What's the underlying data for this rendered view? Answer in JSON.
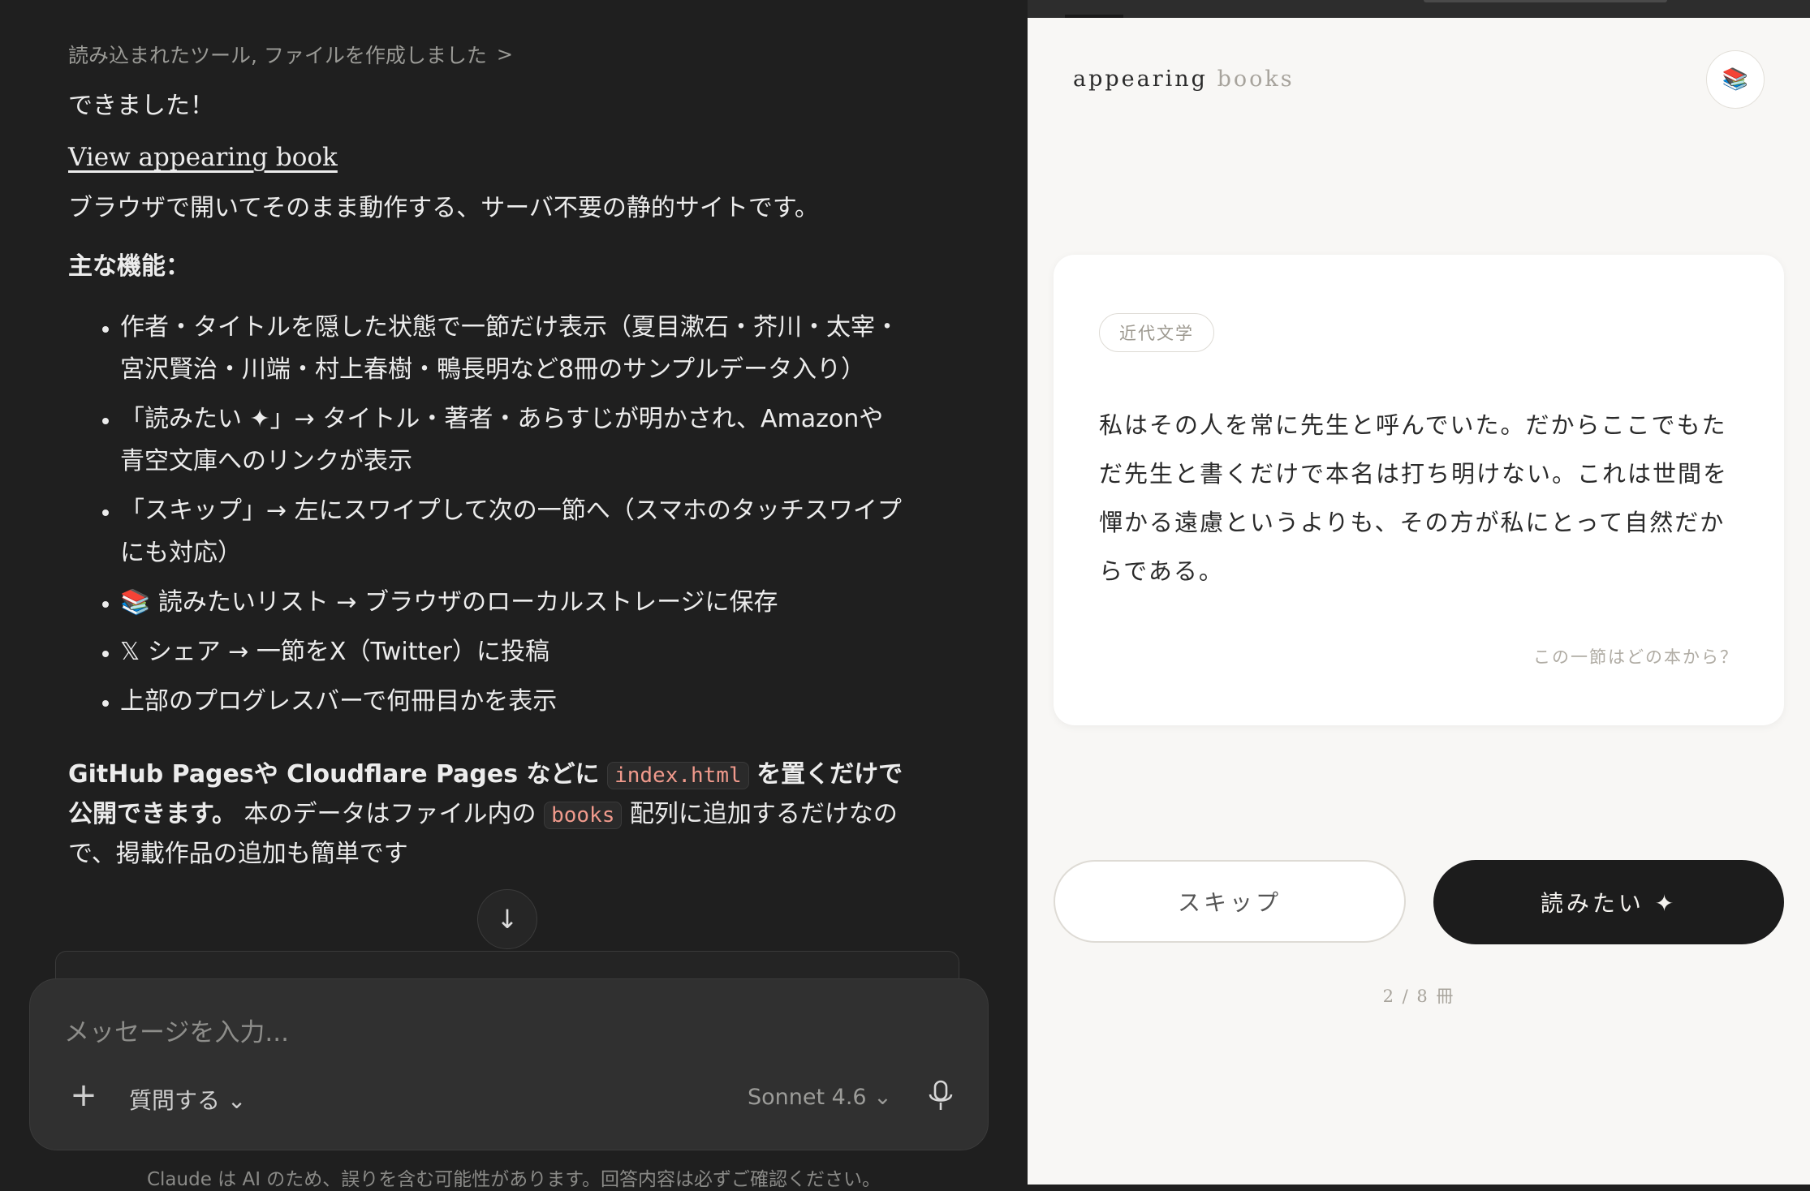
{
  "chat": {
    "tools_summary": "読み込まれたツール, ファイルを作成しました",
    "done_text": "できました！",
    "artifact_link": "View appearing book",
    "description": "ブラウザで開いてそのまま動作する、サーバ不要の静的サイトです。",
    "features_title": "主な機能：",
    "features": [
      "作者・タイトルを隠した状態で一節だけ表示（夏目漱石・芥川・太宰・宮沢賢治・川端・村上春樹・鴨長明など8冊のサンプルデータ入り）",
      "「読みたい ✦」→ タイトル・著者・あらすじが明かされ、Amazonや青空文庫へのリンクが表示",
      "「スキップ」→ 左にスワイプして次の一節へ（スマホのタッチスワイプにも対応）",
      "📚 読みたいリスト → ブラウザのローカルストレージに保存",
      "𝕏 シェア → 一節をX（Twitter）に投稿",
      "上部のプログレスバーで何冊目かを表示"
    ],
    "closing": {
      "bold_1": "GitHub Pagesや Cloudflare Pages などに",
      "code_1": "index.html",
      "bold_2": "を置くだけで公開できます。",
      "text_1": " 本のデータはファイル内の",
      "code_2": "books",
      "text_2": "配列に追加するだけなので、掲載作品の追加も簡単です"
    },
    "composer": {
      "placeholder": "メッセージを入力...",
      "plus": "+",
      "mode": "質問する ⌄",
      "model": "Sonnet 4.6 ⌄"
    },
    "disclaimer": "Claude は AI のため、誤りを含む可能性があります。回答内容は必ずご確認ください。"
  },
  "preview": {
    "logo_main": "appearing",
    "logo_light": "books",
    "list_icon": "📚",
    "card": {
      "tag": "近代文学",
      "passage": "私はその人を常に先生と呼んでいた。だからここでもただ先生と書くだけで本名は打ち明けない。これは世間を憚かる遠慮というよりも、その方が私にとって自然だからである。",
      "hint": "この一節はどの本から？"
    },
    "skip_label": "スキップ",
    "want_label": "読みたい ✦",
    "counter": "2 / 8 冊"
  }
}
